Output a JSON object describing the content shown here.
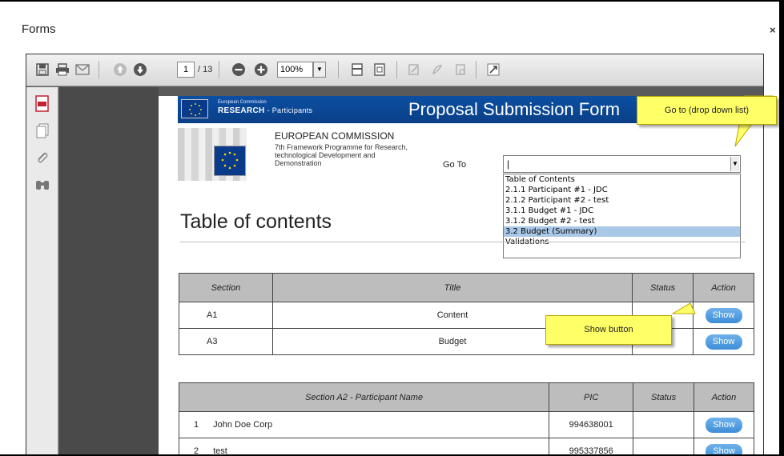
{
  "dialog": {
    "title": "Forms",
    "close_glyph": "×"
  },
  "toolbar": {
    "page_current": "1",
    "page_total": "/ 13",
    "zoom": "100%",
    "icons": [
      "save-icon",
      "print-icon",
      "email-icon",
      "prev-page-icon",
      "next-page-icon",
      "zoom-out-icon",
      "zoom-in-icon",
      "fit-width-icon",
      "fit-page-icon",
      "sign-icon",
      "pen-icon",
      "stamp-icon",
      "expand-icon"
    ]
  },
  "leftbar": {
    "icons": [
      "pdf-icon",
      "pages-icon",
      "attachment-icon",
      "search-binoculars-icon"
    ]
  },
  "form": {
    "header_small": "European Commission",
    "header_research": "RESEARCH",
    "header_participants": "- Participants",
    "banner_title": "Proposal Submission Form",
    "ec_title": "EUROPEAN COMMISSION",
    "ec_sub": "7th Framework Programme for Research, technological Development and Demonstration",
    "goto_label": "Go To",
    "goto_value": "|",
    "goto_options": [
      "Table of Contents",
      "2.1.1 Participant #1 - JDC",
      "2.1.2 Participant #2 - test",
      "3.1.1 Budget #1 - JDC",
      "3.1.2 Budget #2 - test",
      "3.2 Budget (Summary)",
      "Validations"
    ],
    "goto_selected_index": 5,
    "toc_title": "Table of contents"
  },
  "sections_table": {
    "headers": [
      "Section",
      "Title",
      "Status",
      "Action"
    ],
    "rows": [
      {
        "section": "A1",
        "title": "Content",
        "status": "",
        "action": "Show"
      },
      {
        "section": "A3",
        "title": "Budget",
        "status": "",
        "action": "Show"
      }
    ]
  },
  "participants_table": {
    "headers": [
      "Section A2 - Participant Name",
      "PIC",
      "Status",
      "Action"
    ],
    "rows": [
      {
        "num": "1",
        "name": "John Doe Corp",
        "pic": "994638001",
        "status": "",
        "action": "Show"
      },
      {
        "num": "2",
        "name": "test",
        "pic": "995337856",
        "status": "",
        "action": "Show"
      }
    ]
  },
  "callouts": {
    "goto": "Go to (drop down list)",
    "show": "Show button"
  },
  "colors": {
    "banner": "#0c4fa3",
    "callout": "#ffff66",
    "button": "#3d8dd8",
    "selection": "#a9c7e6"
  }
}
